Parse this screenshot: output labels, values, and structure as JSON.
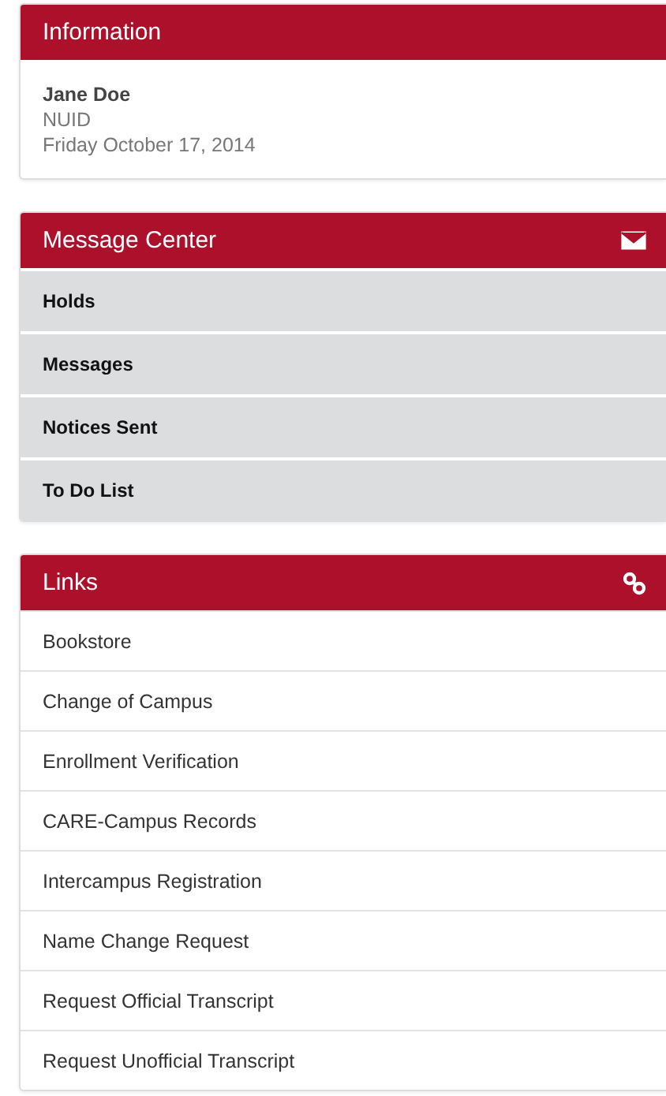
{
  "information": {
    "title": "Information",
    "name": "Jane Doe",
    "id_label": "NUID",
    "date": "Friday October 17, 2014"
  },
  "message_center": {
    "title": "Message Center",
    "items": [
      "Holds",
      "Messages",
      "Notices Sent",
      "To Do List"
    ]
  },
  "links": {
    "title": "Links",
    "items": [
      "Bookstore",
      "Change of Campus",
      "Enrollment Verification",
      "CARE-Campus Records",
      "Intercampus Registration",
      "Name Change Request",
      "Request Official Transcript",
      "Request Unofficial Transcript"
    ]
  }
}
